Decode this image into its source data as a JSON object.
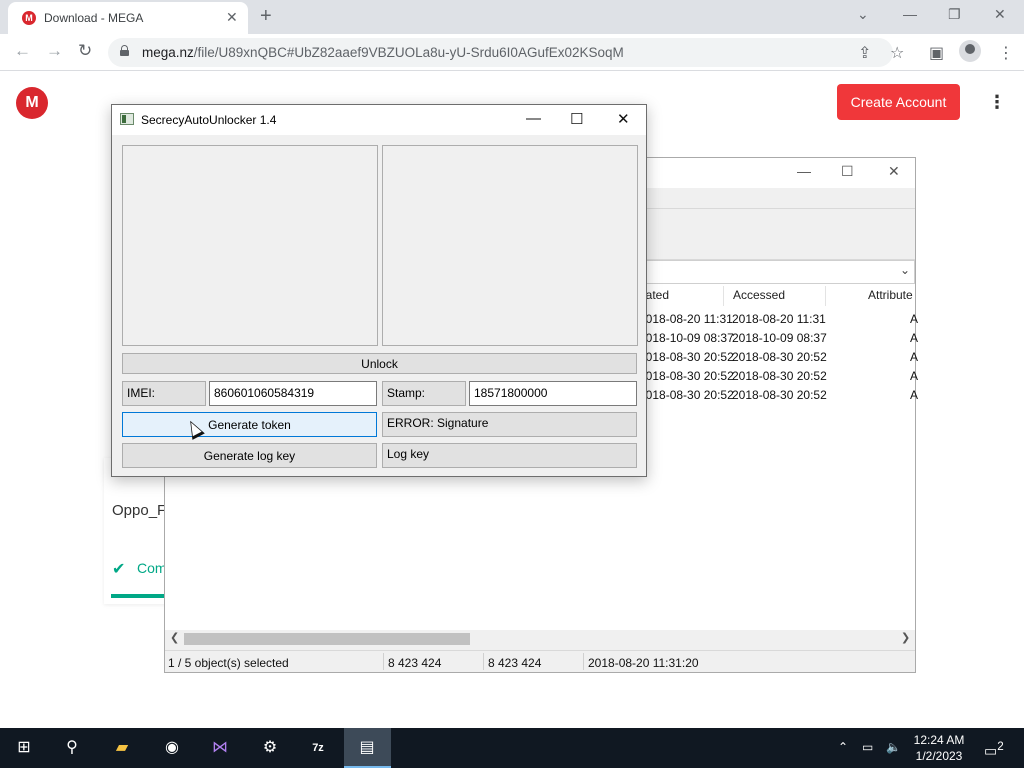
{
  "browser": {
    "tab": {
      "title": "Download - MEGA",
      "favicon": "M"
    },
    "url_host": "mega.nz",
    "url_path": "/file/U89xnQBC#UbZ82aaef9VBZUOLa8u-yU-Srdu6I0AGufEx02KSoqM"
  },
  "mega": {
    "logo": "M",
    "create_account": "Create Account",
    "file_name": "Oppo_F",
    "status_text": "Com",
    "accent_color": "#f0373a",
    "success_color": "#00a886"
  },
  "zip_window": {
    "columns": [
      "eated",
      "Accessed",
      "Attribute"
    ],
    "rows": [
      {
        "created": "2018-08-20 11:31",
        "accessed": "2018-08-20 11:31",
        "attr": "A"
      },
      {
        "created": "2018-10-09 08:37",
        "accessed": "2018-10-09 08:37",
        "attr": "A"
      },
      {
        "created": "2018-08-30 20:52",
        "accessed": "2018-08-30 20:52",
        "attr": "A"
      },
      {
        "created": "2018-08-30 20:52",
        "accessed": "2018-08-30 20:52",
        "attr": "A"
      },
      {
        "created": "2018-08-30 20:52",
        "accessed": "2018-08-30 20:52",
        "attr": "A"
      }
    ],
    "status": {
      "selection": "1 / 5 object(s) selected",
      "size": "8 423 424",
      "packed": "8 423 424",
      "modified": "2018-08-20 11:31:20"
    }
  },
  "unlocker": {
    "title": "SecrecyAutoUnlocker 1.4",
    "unlock_button": "Unlock",
    "imei_label": "IMEI:",
    "imei_value": "860601060584319",
    "stamp_label": "Stamp:",
    "stamp_value": "18571800000",
    "generate_token": "Generate token",
    "generate_log_key": "Generate log key",
    "error_text": "ERROR: Signature",
    "log_key": "Log key"
  },
  "taskbar": {
    "time": "12:24 AM",
    "date": "1/2/2023",
    "notification_count": "2"
  }
}
